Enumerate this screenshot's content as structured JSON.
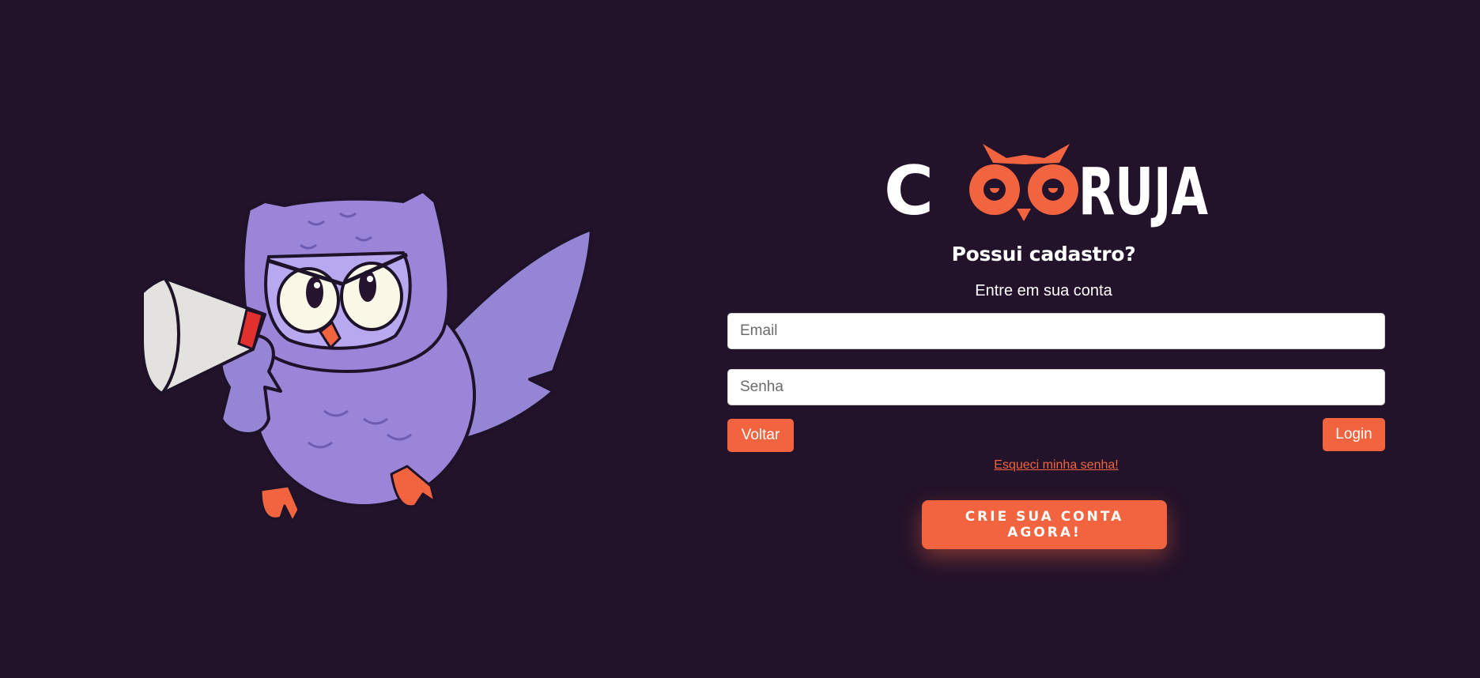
{
  "brand": {
    "name": "COORUJA",
    "colors": {
      "accent": "#f2643f",
      "background": "#22122a",
      "owl_purple": "#9a85d8"
    }
  },
  "illustration": {
    "icon": "owl-megaphone-mascot"
  },
  "login": {
    "heading": "Possui cadastro?",
    "subheading": "Entre em sua conta",
    "email_placeholder": "Email",
    "password_placeholder": "Senha",
    "back_label": "Voltar",
    "login_label": "Login",
    "forgot_label": "Esqueci minha senha!",
    "signup_label": "CRIE SUA CONTA AGORA!"
  }
}
